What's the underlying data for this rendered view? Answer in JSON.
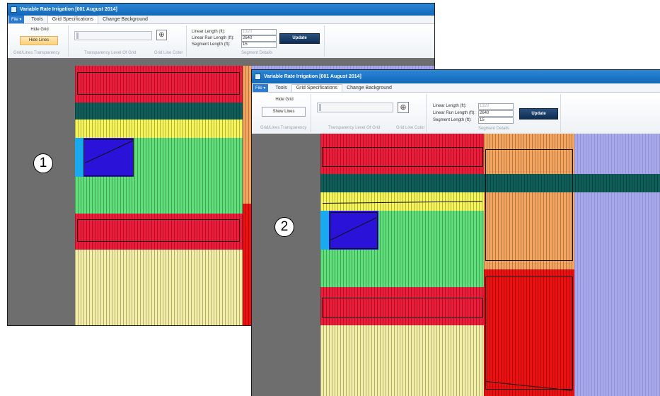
{
  "app": {
    "title": "Variable Rate Irrigation  [001   August 2014]"
  },
  "menu": {
    "file_label": "File",
    "tabs": [
      "Tools",
      "Grid Specifications",
      "Change Background"
    ]
  },
  "ribbon": {
    "hide_grid_label": "Hide Grid",
    "hide_lines_label": "Hide Lines",
    "show_lines_label": "Show Lines",
    "group_grid_lines_transparency": "Grid/Lines Transparency",
    "group_transparency_level": "Transparency Level Of Grid",
    "group_grid_line_color": "Grid Line Color",
    "linear_length_label": "Linear Length (ft):",
    "linear_length_value": "1320",
    "linear_run_length_label": "Linear Run Length (ft):",
    "linear_run_length_value": "2640",
    "segment_length_label": "Segment Length (ft):",
    "segment_length_value": "15",
    "update_label": "Update",
    "group_segment_details": "Segment Details"
  },
  "callouts": {
    "first": "1",
    "second": "2"
  },
  "colors": {
    "red": "#ee1c3a",
    "dark_green": "#0f5e5a",
    "yellow": "#f6f55a",
    "green": "#5fe07b",
    "blue": "#2b12d8",
    "cyan": "#19a9ee",
    "pale_yellow": "#f3f0a6",
    "orange": "#f6a55e",
    "bright_red": "#ee1010",
    "lavender": "#a7a7ee",
    "canvas_gray": "#6e6e6e"
  }
}
